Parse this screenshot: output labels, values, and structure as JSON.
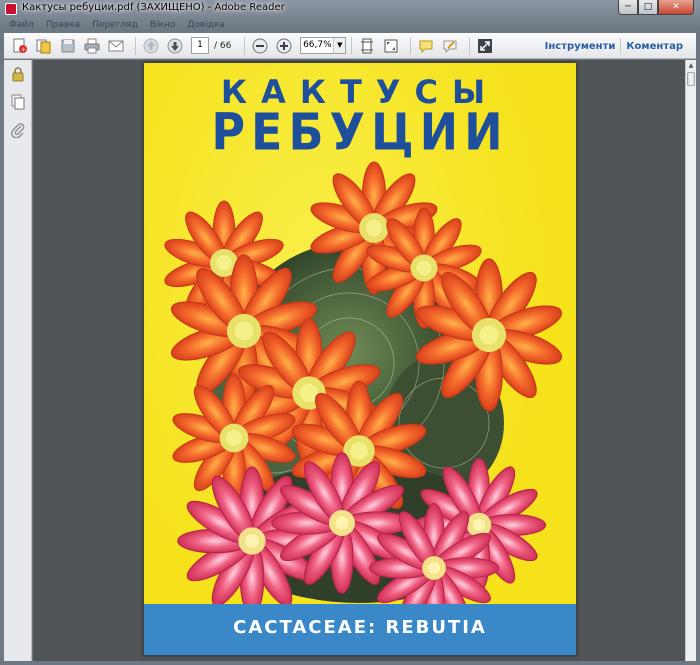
{
  "window": {
    "title": "Кактусы ребуции.pdf (ЗАХИЩЕНО) - Adobe Reader",
    "minimize": "─",
    "maximize": "□",
    "close": "✕"
  },
  "menu": {
    "items": [
      "Файл",
      "Правка",
      "Перегляд",
      "Вікно",
      "Довідка"
    ]
  },
  "toolbar": {
    "current_page": "1",
    "total_pages": "/ 66",
    "zoom": "66,7%",
    "tools_label": "Інструменти",
    "comment_label": "Коментар"
  },
  "cover": {
    "title_line1": "КАКТУСЫ",
    "title_line2": "РЕБУЦИИ",
    "footer": "CACTACEAE: REBUTIA"
  },
  "colors": {
    "cover_yellow": "#f5e21a",
    "title_blue": "#1d4f9c",
    "footer_blue": "#3b88c8",
    "petal_orange": "#f0502a",
    "petal_red": "#e5385a",
    "link_blue": "#2a5da6"
  }
}
